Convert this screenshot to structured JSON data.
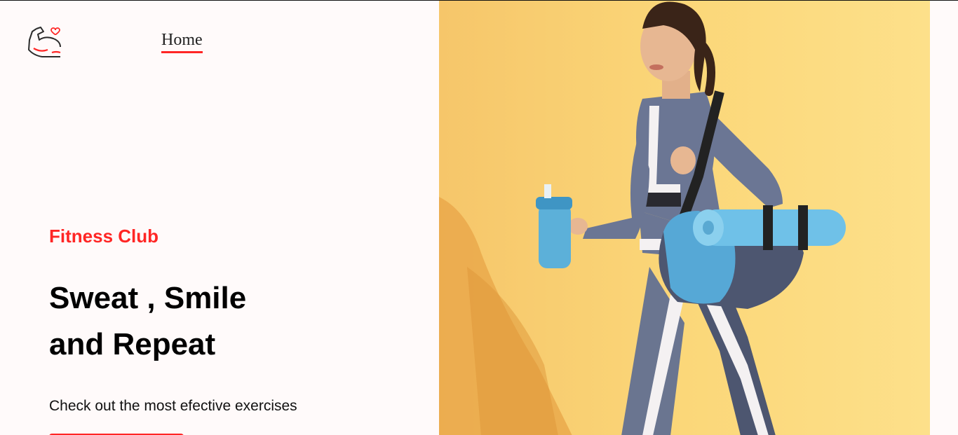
{
  "navbar": {
    "logo_icon": "flexed-arm-heart-icon",
    "home_link": "Home"
  },
  "hero": {
    "eyebrow": "Fitness Club",
    "title_line1": "Sweat , Smile",
    "title_line2": "and Repeat",
    "subtitle": "Check out the most efective exercises",
    "banner_image": "woman-walking-with-gym-bag-and-bottle"
  },
  "colors": {
    "accent": "#ff2625",
    "page_background": "#fffafa",
    "banner_background": "#fbd779",
    "text": "#000000"
  }
}
